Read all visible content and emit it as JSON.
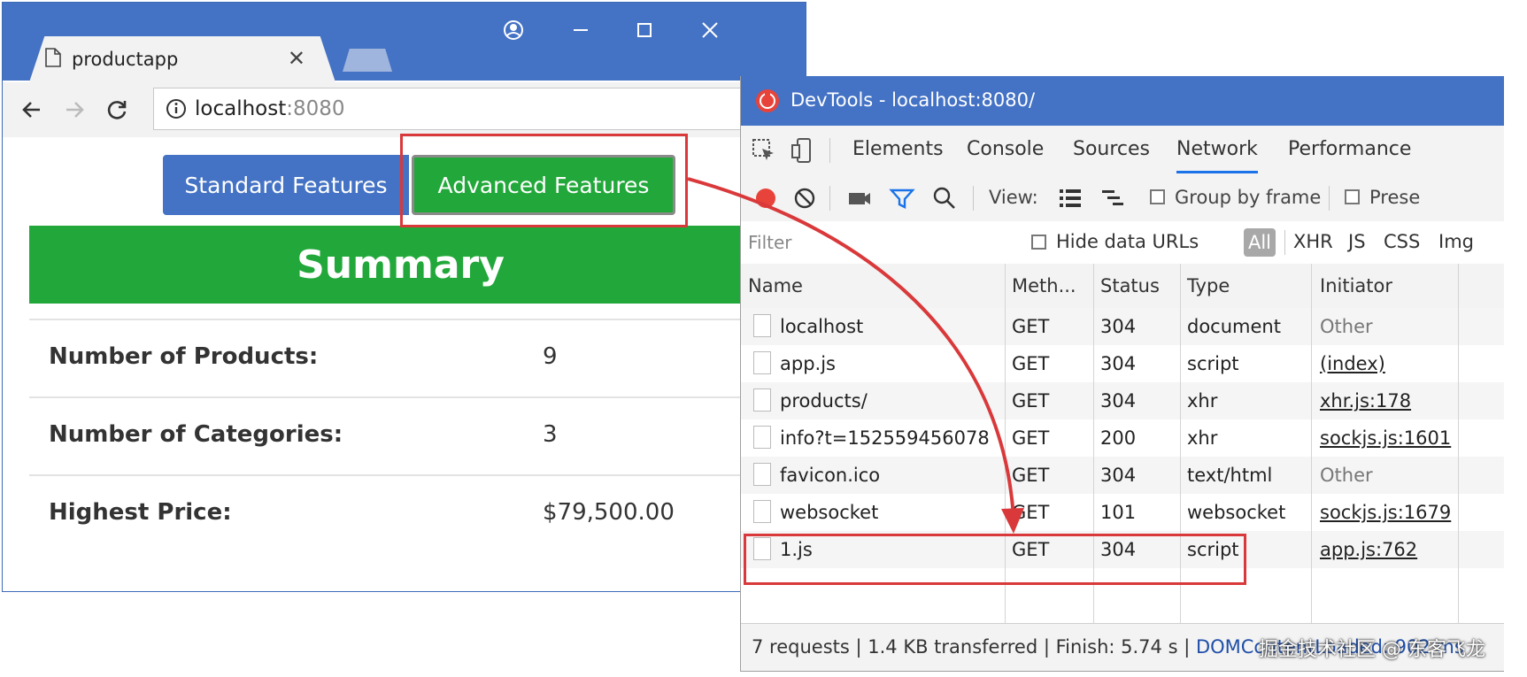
{
  "browser": {
    "tab_title": "productapp",
    "url_host": "localhost",
    "url_port": ":8080",
    "buttons": {
      "standard": "Standard Features",
      "advanced": "Advanced Features"
    },
    "summary_title": "Summary",
    "summary_rows": [
      {
        "label": "Number of Products:",
        "value": "9"
      },
      {
        "label": "Number of Categories:",
        "value": "3"
      },
      {
        "label": "Highest Price:",
        "value": "$79,500.00"
      }
    ],
    "colors": {
      "titlebar": "#4472c4",
      "primary_button": "#4472c4",
      "success": "#22a83a"
    }
  },
  "devtools": {
    "title": "DevTools - localhost:8080/",
    "tabs": [
      "Elements",
      "Console",
      "Sources",
      "Network",
      "Performance"
    ],
    "active_tab": "Network",
    "toolbar": {
      "view_label": "View:",
      "group_by_frame": "Group by frame",
      "preserve_log": "Prese"
    },
    "filter": {
      "placeholder": "Filter",
      "hide_data_urls": "Hide data URLs",
      "types": [
        "All",
        "XHR",
        "JS",
        "CSS",
        "Img"
      ]
    },
    "columns": [
      "Name",
      "Meth...",
      "Status",
      "Type",
      "Initiator"
    ],
    "rows": [
      {
        "name": "localhost",
        "method": "GET",
        "status": "304",
        "type": "document",
        "initiator": "Other"
      },
      {
        "name": "app.js",
        "method": "GET",
        "status": "304",
        "type": "script",
        "initiator": "(index)"
      },
      {
        "name": "products/",
        "method": "GET",
        "status": "304",
        "type": "xhr",
        "initiator": "xhr.js:178"
      },
      {
        "name": "info?t=152559456078",
        "method": "GET",
        "status": "200",
        "type": "xhr",
        "initiator": "sockjs.js:1601"
      },
      {
        "name": "favicon.ico",
        "method": "GET",
        "status": "304",
        "type": "text/html",
        "initiator": "Other"
      },
      {
        "name": "websocket",
        "method": "GET",
        "status": "101",
        "type": "websocket",
        "initiator": "sockjs.js:1679"
      },
      {
        "name": "1.js",
        "method": "GET",
        "status": "304",
        "type": "script",
        "initiator": "app.js:762"
      }
    ],
    "status_bar": {
      "requests": "7 requests",
      "transferred": "1.4 KB transferred",
      "finish": "Finish: 5.74 s",
      "dom": "DOMContentLoaded: 902 ms"
    },
    "colors": {
      "record": "#e8433a",
      "filter_active": "#1a73e8",
      "highlight": "#d9393a"
    }
  },
  "watermark": "掘金技术社区 @ 东客飞龙"
}
